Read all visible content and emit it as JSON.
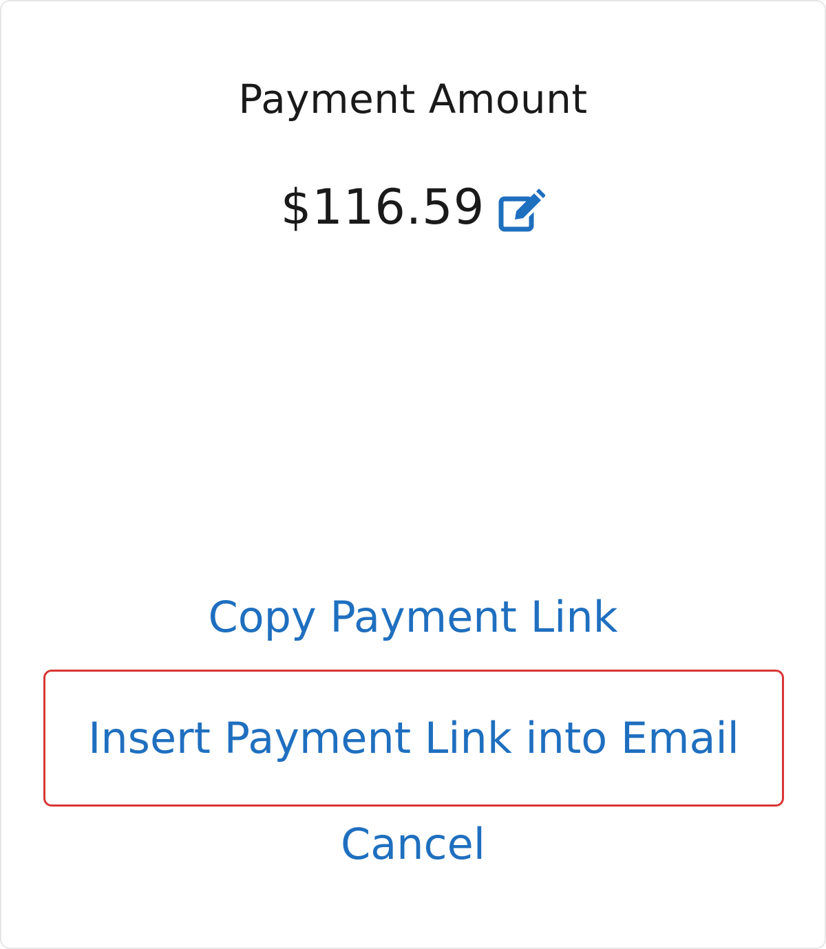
{
  "payment": {
    "title": "Payment Amount",
    "amount": "$116.59",
    "edit_icon": "edit-icon"
  },
  "actions": {
    "copy_link_label": "Copy Payment Link",
    "insert_link_label": "Insert Payment Link into Email",
    "cancel_label": "Cancel"
  },
  "colors": {
    "link": "#1f6fbf",
    "highlight_border": "#d93535",
    "text": "#1a1a1a"
  }
}
